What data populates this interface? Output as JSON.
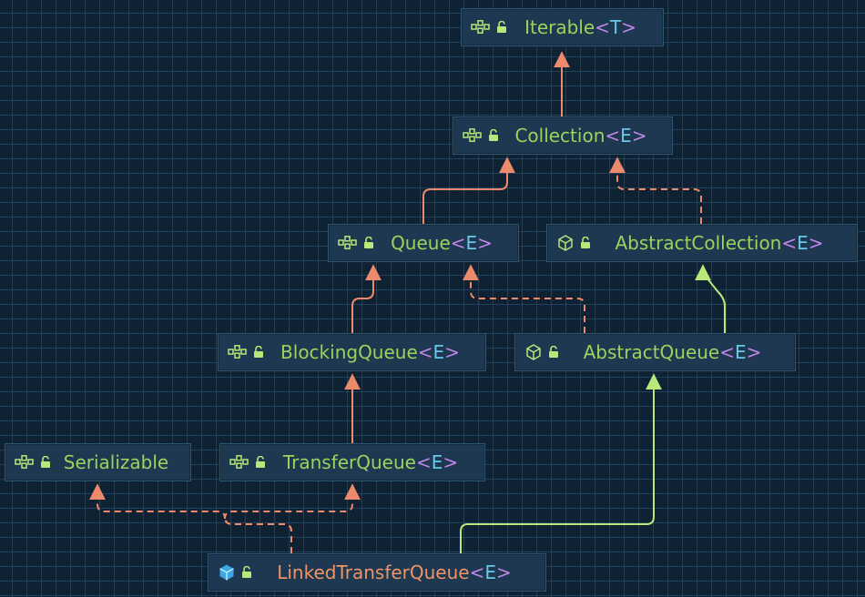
{
  "colors": {
    "background": "#0f2233",
    "grid": "#3d6f96",
    "node_fill": "#1d3850",
    "node_border": "#2e5673",
    "interface_name": "#9cd35d",
    "abstract_name": "#9cd35d",
    "concrete_name": "#ee9466",
    "bracket": "#c187e8",
    "type_param": "#69c8e8",
    "extends_edge": "#ee8a6c",
    "class_edge": "#b7e879"
  },
  "nodes": {
    "iterable": {
      "name": "Iterable",
      "open": "<",
      "param": "T",
      "close": ">",
      "kind": "interface",
      "icon": "interface-icon"
    },
    "collection": {
      "name": "Collection",
      "open": "<",
      "param": "E",
      "close": ">",
      "kind": "interface",
      "icon": "interface-icon"
    },
    "queue": {
      "name": "Queue",
      "open": "<",
      "param": "E",
      "close": ">",
      "kind": "interface",
      "icon": "interface-icon"
    },
    "abstract_collection": {
      "name": "AbstractCollection",
      "open": "<",
      "param": "E",
      "close": ">",
      "kind": "abstract-class",
      "icon": "abstract-class-icon"
    },
    "blocking_queue": {
      "name": "BlockingQueue",
      "open": "<",
      "param": "E",
      "close": ">",
      "kind": "interface",
      "icon": "interface-icon"
    },
    "abstract_queue": {
      "name": "AbstractQueue",
      "open": "<",
      "param": "E",
      "close": ">",
      "kind": "abstract-class",
      "icon": "abstract-class-icon"
    },
    "serializable": {
      "name": "Serializable",
      "open": "",
      "param": "",
      "close": "",
      "kind": "interface",
      "icon": "interface-icon"
    },
    "transfer_queue": {
      "name": "TransferQueue",
      "open": "<",
      "param": "E",
      "close": ">",
      "kind": "interface",
      "icon": "interface-icon"
    },
    "linked_transfer_queue": {
      "name": "LinkedTransferQueue",
      "open": "<",
      "param": "E",
      "close": ">",
      "kind": "class",
      "icon": "class-icon"
    }
  },
  "edges": [
    {
      "from": "collection",
      "to": "iterable",
      "type": "extends"
    },
    {
      "from": "queue",
      "to": "collection",
      "type": "extends"
    },
    {
      "from": "abstract_collection",
      "to": "collection",
      "type": "implements"
    },
    {
      "from": "blocking_queue",
      "to": "queue",
      "type": "extends"
    },
    {
      "from": "abstract_queue",
      "to": "queue",
      "type": "implements"
    },
    {
      "from": "abstract_queue",
      "to": "abstract_collection",
      "type": "class-extends"
    },
    {
      "from": "transfer_queue",
      "to": "blocking_queue",
      "type": "extends"
    },
    {
      "from": "linked_transfer_queue",
      "to": "serializable",
      "type": "implements"
    },
    {
      "from": "linked_transfer_queue",
      "to": "transfer_queue",
      "type": "implements"
    },
    {
      "from": "linked_transfer_queue",
      "to": "abstract_queue",
      "type": "class-extends"
    }
  ]
}
